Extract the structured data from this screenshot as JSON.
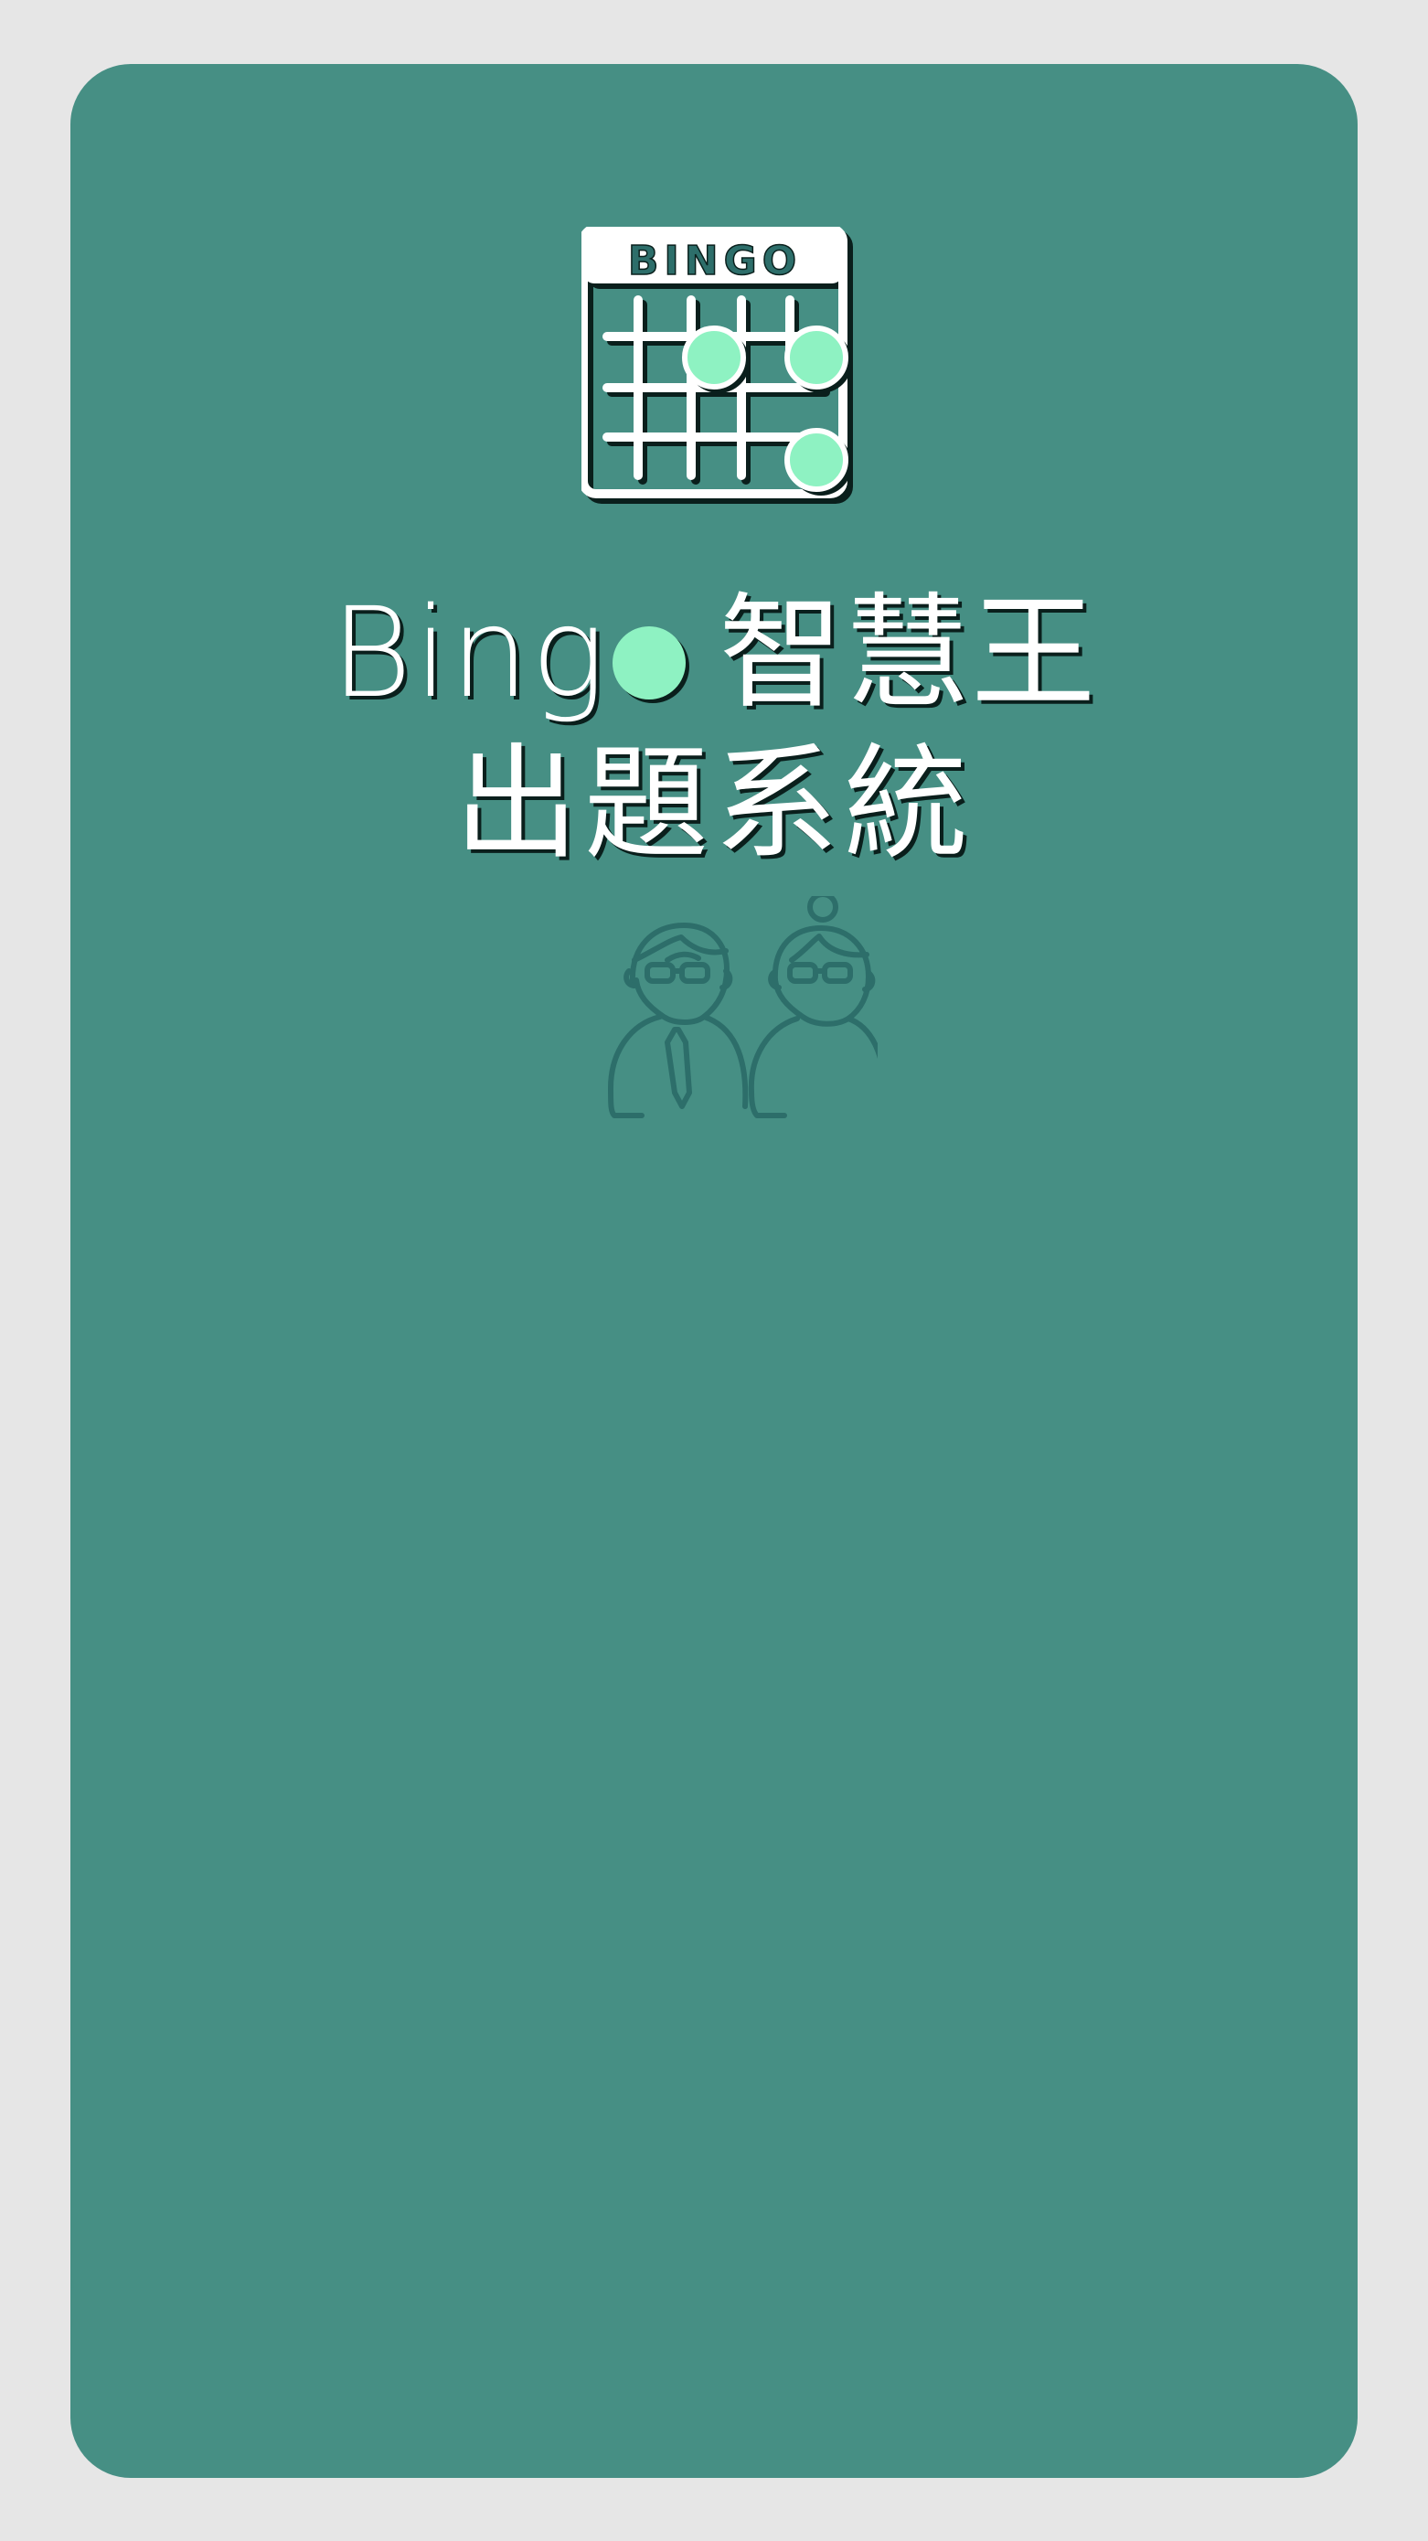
{
  "logo": {
    "icon": "bingo-card-icon",
    "label": "BINGO"
  },
  "title": {
    "line1_word": "Bing",
    "line1_rest": "智慧王",
    "line2": "出題系統"
  },
  "illustration": {
    "icon": "teachers-icon"
  },
  "colors": {
    "background": "#e6e6e6",
    "card": "#468f84",
    "accent": "#8ef2c2",
    "text": "#ffffff",
    "outline": "#2d6e6a"
  }
}
